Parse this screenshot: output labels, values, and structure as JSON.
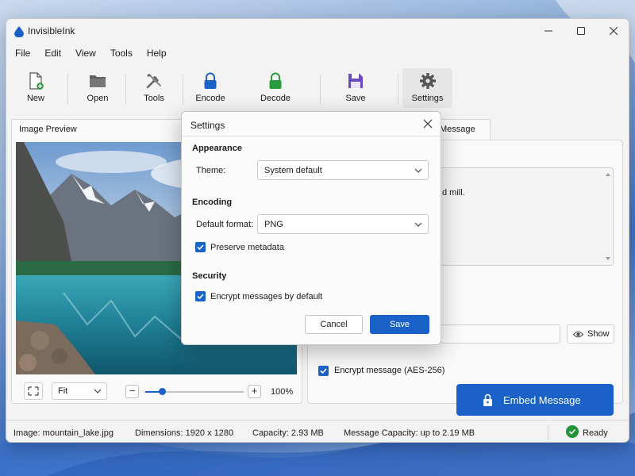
{
  "app": {
    "title": "InvisibleInk",
    "accent_color": "#1a62c7"
  },
  "menu": [
    "File",
    "Edit",
    "View",
    "Tools",
    "Help"
  ],
  "toolbar": {
    "new_label": "New",
    "open_label": "Open",
    "tools_label": "Tools",
    "encode_label": "Encode",
    "decode_label": "Decode",
    "save_label": "Save",
    "settings_label": "Settings"
  },
  "image_preview": {
    "title": "Image Preview",
    "fit_value": "Fit",
    "zoom_text": "100%",
    "zoom_level": 0.17
  },
  "message_panel": {
    "tab_label_partial": "Message",
    "message_text_partial": "d mill.",
    "show_label": "Show",
    "encrypt_label": "Encrypt message (AES-256)",
    "embed_label": "Embed Message"
  },
  "status": {
    "image": "Image: mountain_lake.jpg",
    "dimensions": "Dimensions: 1920 x 1280",
    "capacity": "Capacity: 2.93 MB",
    "message_capacity": "Message Capacity: up to 2.19 MB",
    "ready": "Ready"
  },
  "settings_dialog": {
    "title": "Settings",
    "appearance_head": "Appearance",
    "theme_label": "Theme:",
    "theme_value": "System default",
    "encoding_head": "Encoding",
    "format_label": "Default format:",
    "format_value": "PNG",
    "preserve_label": "Preserve metadata",
    "preserve_checked": true,
    "security_head": "Security",
    "encrypt_default_label": "Encrypt messages by default",
    "encrypt_default_checked": true,
    "cancel_label": "Cancel",
    "save_label": "Save"
  }
}
